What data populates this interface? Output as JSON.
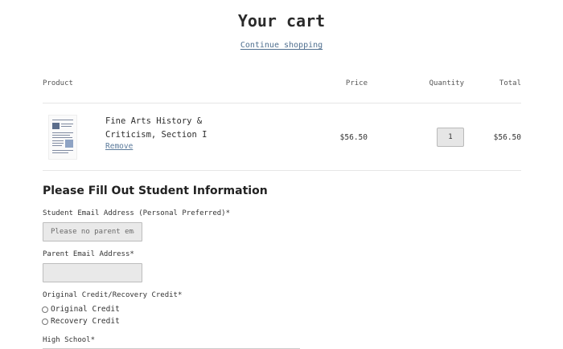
{
  "page": {
    "title": "Your cart",
    "continue_label": "Continue shopping"
  },
  "table": {
    "headers": {
      "product": "Product",
      "price": "Price",
      "quantity": "Quantity",
      "total": "Total"
    },
    "item": {
      "name": "Fine Arts History & Criticism, Section I",
      "remove_label": "Remove",
      "price": "$56.50",
      "quantity": "1",
      "total": "$56.50",
      "thumbnail_icon": "document-thumbnail-icon"
    }
  },
  "form": {
    "title": "Please Fill Out Student Information",
    "student_email": {
      "label": "Student Email Address (Personal Preferred)*",
      "placeholder": "Please no parent emails",
      "value": ""
    },
    "parent_email": {
      "label": "Parent Email Address*",
      "value": ""
    },
    "credit": {
      "label": "Original Credit/Recovery Credit*",
      "options": [
        "Original Credit",
        "Recovery Credit"
      ]
    },
    "high_school": {
      "label": "High School*"
    }
  },
  "colors": {
    "link": "#4f6f8f",
    "input_bg": "#e9e9e9",
    "divider": "#e6e6e6"
  }
}
